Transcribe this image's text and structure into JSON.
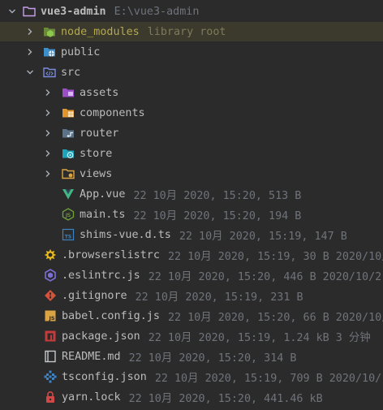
{
  "project": {
    "name": "vue3-admin",
    "path": "E:\\vue3-admin"
  },
  "folders": {
    "node_modules": {
      "name": "node_modules",
      "meta": "library root"
    },
    "public": {
      "name": "public"
    },
    "src": {
      "name": "src"
    },
    "assets": {
      "name": "assets"
    },
    "components": {
      "name": "components"
    },
    "router": {
      "name": "router"
    },
    "store": {
      "name": "store"
    },
    "views": {
      "name": "views"
    }
  },
  "files": {
    "app_vue": {
      "name": "App.vue",
      "meta": "22 10月 2020, 15:20, 513 B"
    },
    "main_ts": {
      "name": "main.ts",
      "meta": "22 10月 2020, 15:20, 194 B"
    },
    "shims": {
      "name": "shims-vue.d.ts",
      "meta": "22 10月 2020, 15:19, 147 B"
    },
    "browserslistrc": {
      "name": ".browserslistrc",
      "meta": "22 10月 2020, 15:19, 30 B 2020/10/"
    },
    "eslintrc": {
      "name": ".eslintrc.js",
      "meta": "22 10月 2020, 15:20, 446 B 2020/10/2"
    },
    "gitignore": {
      "name": ".gitignore",
      "meta": "22 10月 2020, 15:19, 231 B"
    },
    "babel": {
      "name": "babel.config.js",
      "meta": "22 10月 2020, 15:20, 66 B 2020/10/"
    },
    "package": {
      "name": "package.json",
      "meta": "22 10月 2020, 15:19, 1.24 kB 3 分钟"
    },
    "readme": {
      "name": "README.md",
      "meta": "22 10月 2020, 15:20, 314 B"
    },
    "tsconfig": {
      "name": "tsconfig.json",
      "meta": "22 10月 2020, 15:19, 709 B 2020/10/"
    },
    "yarnlock": {
      "name": "yarn.lock",
      "meta": "22 10月 2020, 15:20, 441.46 kB"
    }
  },
  "colors": {
    "background": "#2b2b2b",
    "library_highlight": "#3c3a2d",
    "text": "#bbbbbb",
    "meta_text": "#6f737a",
    "library_text": "#b6a84b"
  }
}
